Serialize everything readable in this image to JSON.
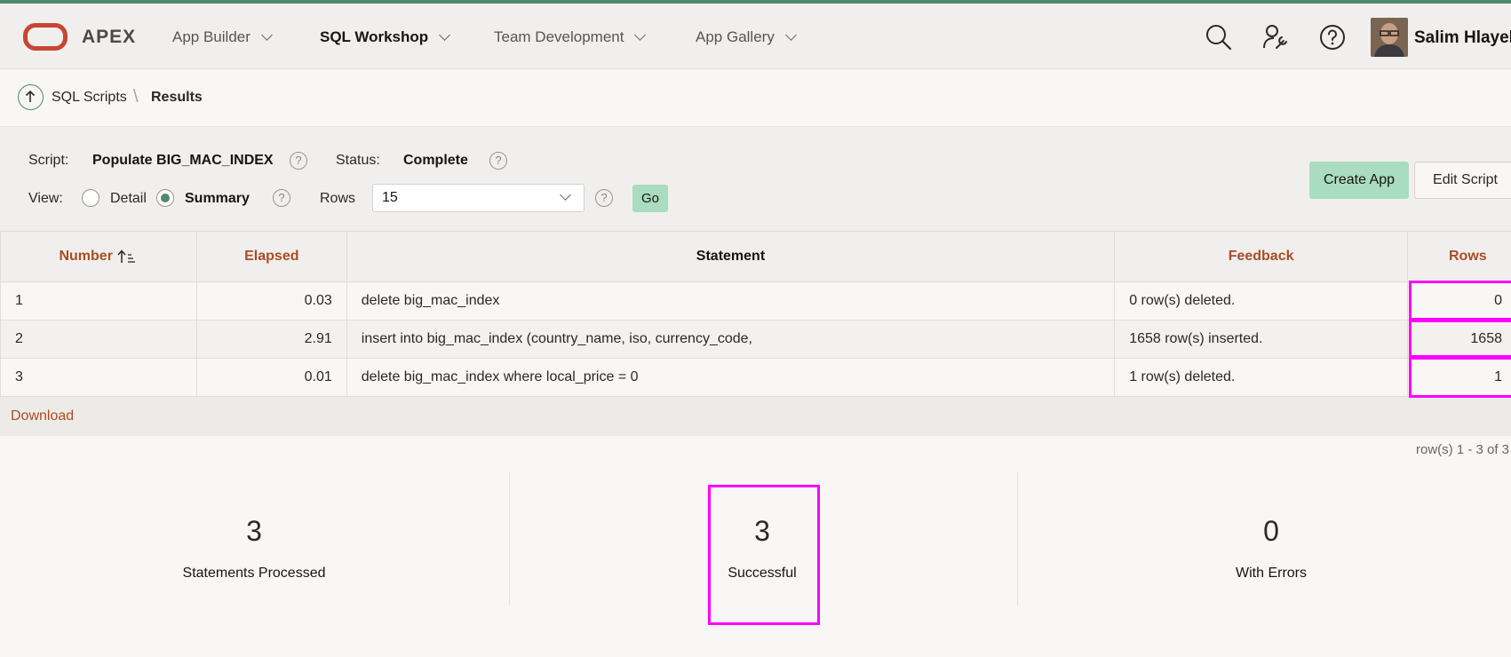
{
  "header": {
    "brand": "APEX",
    "nav": [
      {
        "label": "App Builder",
        "active": false
      },
      {
        "label": "SQL Workshop",
        "active": true
      },
      {
        "label": "Team Development",
        "active": false
      },
      {
        "label": "App Gallery",
        "active": false
      }
    ],
    "icons": [
      "search-icon",
      "admin-tools-icon",
      "help-icon"
    ],
    "user_name": "Salim Hlayel"
  },
  "breadcrumb": {
    "parent": "SQL Scripts",
    "current": "Results"
  },
  "info": {
    "script_label": "Script:",
    "script_value": "Populate BIG_MAC_INDEX",
    "status_label": "Status:",
    "status_value": "Complete",
    "view_label": "View:",
    "view_options": [
      {
        "label": "Detail",
        "selected": false
      },
      {
        "label": "Summary",
        "selected": true
      }
    ],
    "rows_label": "Rows",
    "rows_value": "15",
    "go_label": "Go",
    "help_glyph": "?"
  },
  "buttons": {
    "create_app": "Create App",
    "edit_script": "Edit Script"
  },
  "table": {
    "columns": [
      "Number",
      "Elapsed",
      "Statement",
      "Feedback",
      "Rows"
    ],
    "rows": [
      {
        "number": "1",
        "elapsed": "0.03",
        "statement": "delete big_mac_index",
        "feedback": "0 row(s) deleted.",
        "rows": "0"
      },
      {
        "number": "2",
        "elapsed": "2.91",
        "statement": "insert into big_mac_index (country_name, iso, currency_code,",
        "feedback": "1658 row(s) inserted.",
        "rows": "1658"
      },
      {
        "number": "3",
        "elapsed": "0.01",
        "statement": "delete big_mac_index where local_price = 0",
        "feedback": "1 row(s) deleted.",
        "rows": "1"
      }
    ]
  },
  "footer": {
    "download": "Download",
    "pagination": "row(s) 1 - 3 of 3"
  },
  "summary": [
    {
      "value": "3",
      "caption": "Statements Processed"
    },
    {
      "value": "3",
      "caption": "Successful"
    },
    {
      "value": "0",
      "caption": "With Errors"
    }
  ],
  "colors": {
    "accent_green": "#4f8a6a",
    "button_green": "#a9dcc0",
    "link_orange": "#a94d26",
    "highlight_magenta": "#ff00ff",
    "oracle_red": "#c74634"
  }
}
